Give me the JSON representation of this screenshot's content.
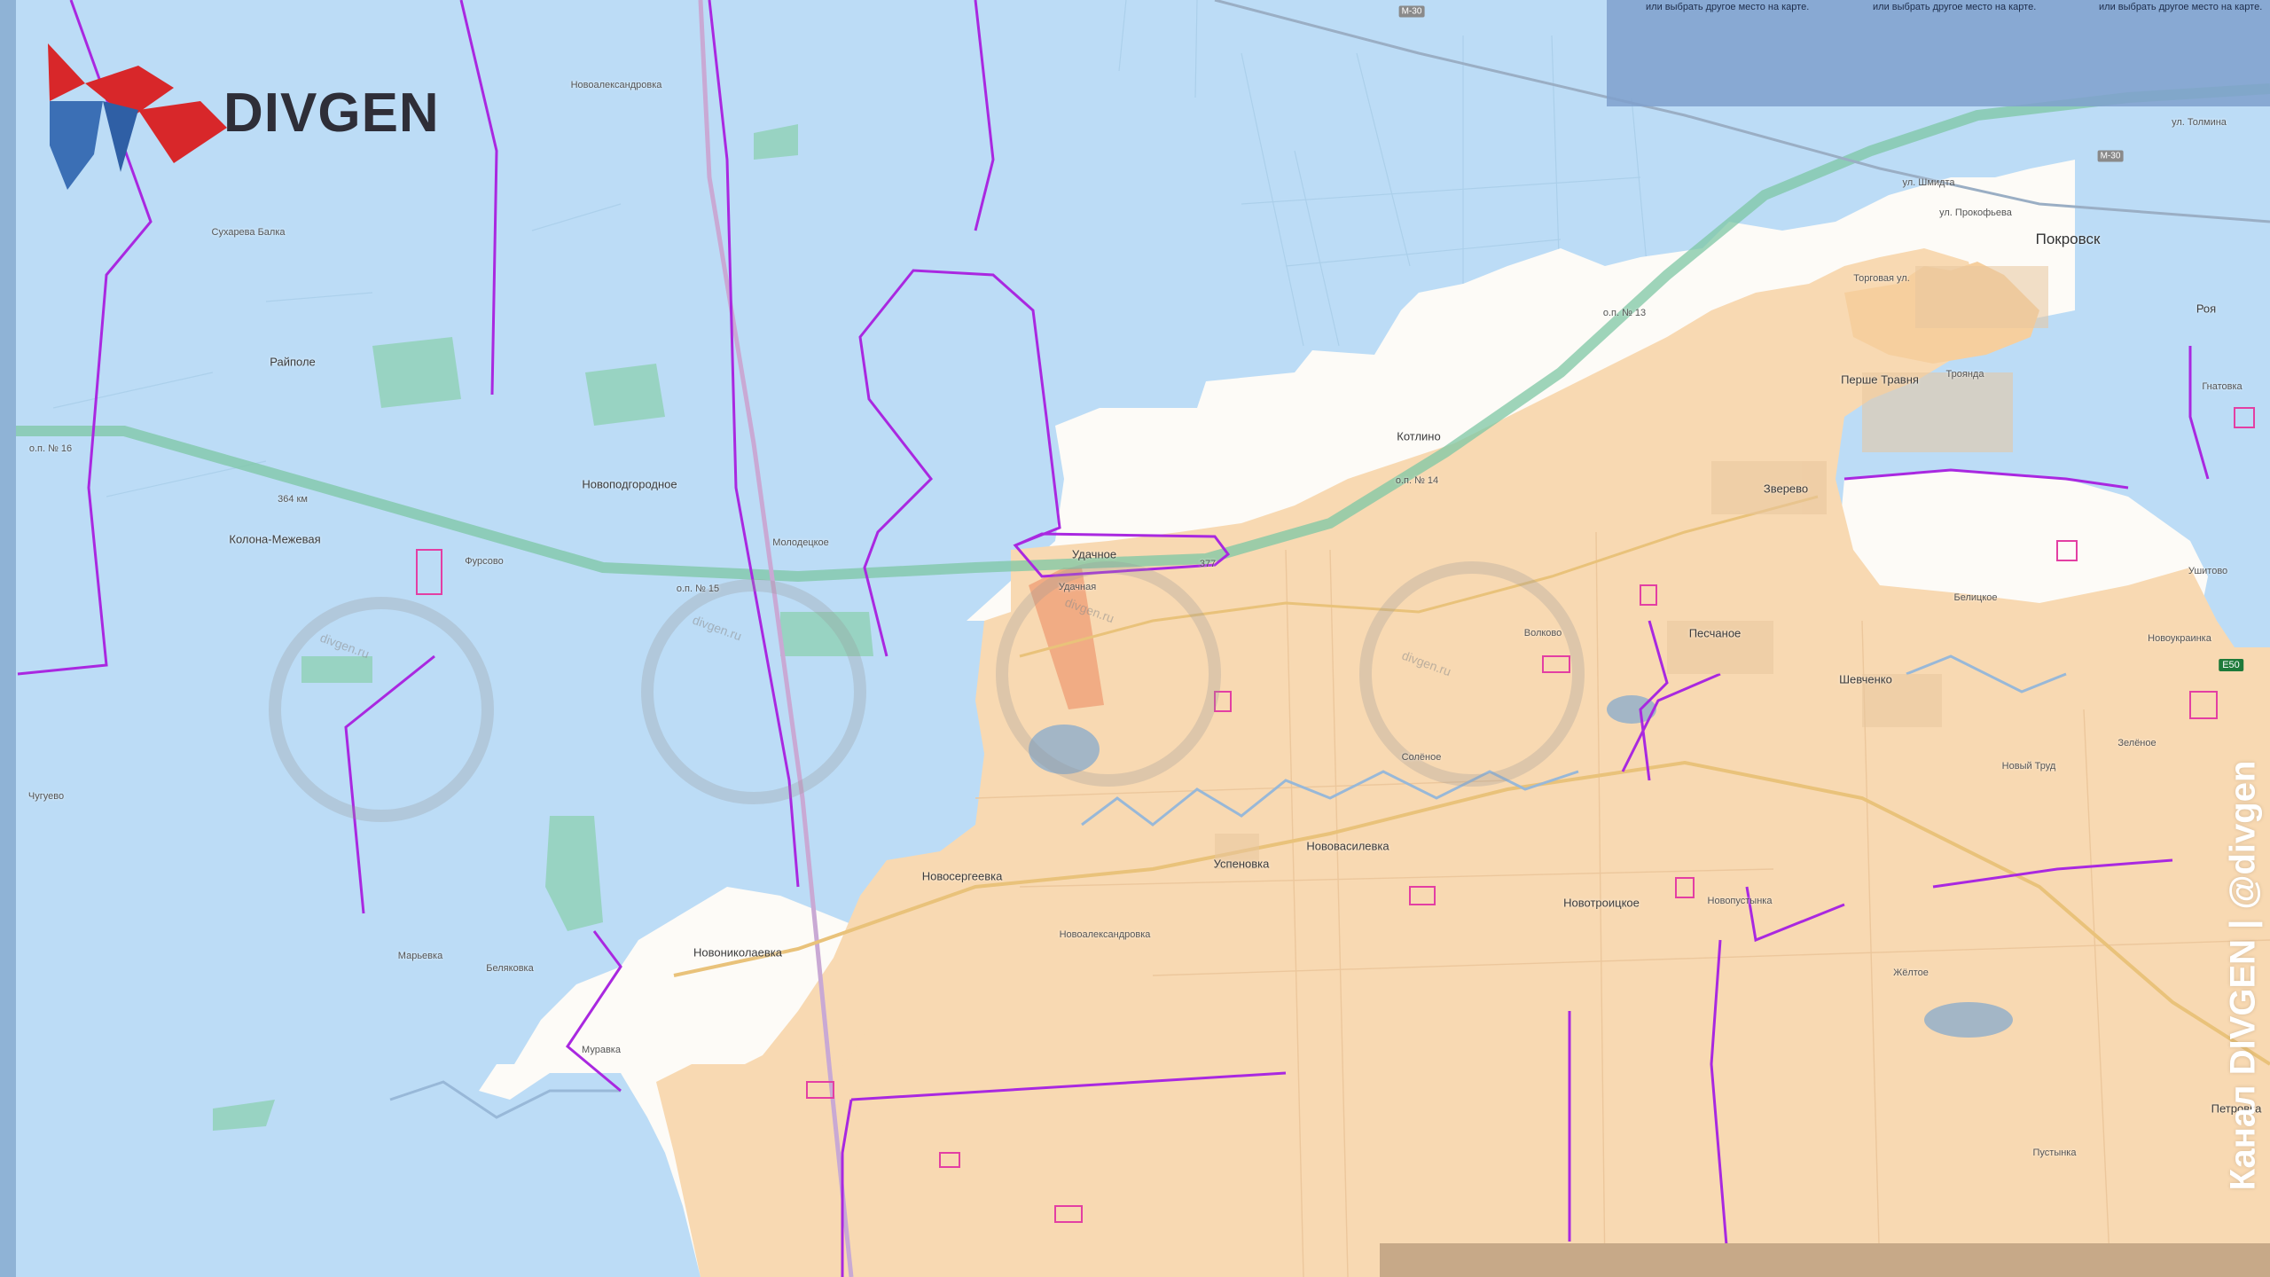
{
  "logo": {
    "name": "DIVGEN"
  },
  "channel_label": "Канал DIVGEN | @divgen",
  "banner": {
    "texts": [
      "или выбрать другое место на карте.",
      "или выбрать другое место на карте.",
      "или выбрать другое место на карте."
    ]
  },
  "colors": {
    "water_zone": "#bcdcf6",
    "controlled_zone": "#f8d9b2",
    "contested_zone": "#f1ac84",
    "gray_zone": "#ffffff",
    "front_line": "#a928e0",
    "road_highway": "#7ec7a4"
  },
  "watermark": "divgen.ru",
  "places": [
    {
      "name": "Новоалександровка",
      "size": "small"
    },
    {
      "name": "Сухарева Балка",
      "size": "small"
    },
    {
      "name": "Райполе",
      "size": "normal"
    },
    {
      "name": "о.п. № 16",
      "size": "small"
    },
    {
      "name": "364 км",
      "size": "small"
    },
    {
      "name": "Новоподгородное",
      "size": "normal"
    },
    {
      "name": "Колона-Межевая",
      "size": "normal"
    },
    {
      "name": "Фурсово",
      "size": "small"
    },
    {
      "name": "Молодецкое",
      "size": "small"
    },
    {
      "name": "о.п. № 15",
      "size": "small"
    },
    {
      "name": "Удачное",
      "size": "normal"
    },
    {
      "name": "Удачная",
      "size": "small"
    },
    {
      "name": "377",
      "size": "small"
    },
    {
      "name": "Котлино",
      "size": "normal"
    },
    {
      "name": "о.п. № 14",
      "size": "small"
    },
    {
      "name": "о.п. № 13",
      "size": "small"
    },
    {
      "name": "Торговая ул.",
      "size": "small"
    },
    {
      "name": "Покровск",
      "size": "big"
    },
    {
      "name": "ул. Прокофьева",
      "size": "small"
    },
    {
      "name": "ул. Шмидта",
      "size": "small"
    },
    {
      "name": "ул. Толмина",
      "size": "small"
    },
    {
      "name": "Першe Травня",
      "size": "normal"
    },
    {
      "name": "Троянда",
      "size": "small"
    },
    {
      "name": "Роя",
      "size": "normal"
    },
    {
      "name": "Гнатовка",
      "size": "small"
    },
    {
      "name": "Зверево",
      "size": "normal"
    },
    {
      "name": "Волково",
      "size": "small"
    },
    {
      "name": "Песчаное",
      "size": "normal"
    },
    {
      "name": "Белицкое",
      "size": "small"
    },
    {
      "name": "Новоукраинка",
      "size": "small"
    },
    {
      "name": "Шевченко",
      "size": "normal"
    },
    {
      "name": "Новый Труд",
      "size": "small"
    },
    {
      "name": "Зелёное",
      "size": "small"
    },
    {
      "name": "Солёное",
      "size": "small"
    },
    {
      "name": "Чугуево",
      "size": "small"
    },
    {
      "name": "Новосергеевка",
      "size": "normal"
    },
    {
      "name": "Успеновка",
      "size": "normal"
    },
    {
      "name": "Нововасилевка",
      "size": "normal"
    },
    {
      "name": "Новоалександровка",
      "size": "small"
    },
    {
      "name": "Новониколаевка",
      "size": "normal"
    },
    {
      "name": "Новотроицкое",
      "size": "normal"
    },
    {
      "name": "Новопустынка",
      "size": "small"
    },
    {
      "name": "Марьевка",
      "size": "small"
    },
    {
      "name": "Беляковка",
      "size": "small"
    },
    {
      "name": "Муравка",
      "size": "small"
    },
    {
      "name": "Жёлтое",
      "size": "small"
    },
    {
      "name": "Петровка",
      "size": "normal"
    },
    {
      "name": "Пустынка",
      "size": "small"
    },
    {
      "name": "Ушитово",
      "size": "small"
    }
  ],
  "road_labels": [
    "М-30",
    "М-30",
    "E50"
  ]
}
